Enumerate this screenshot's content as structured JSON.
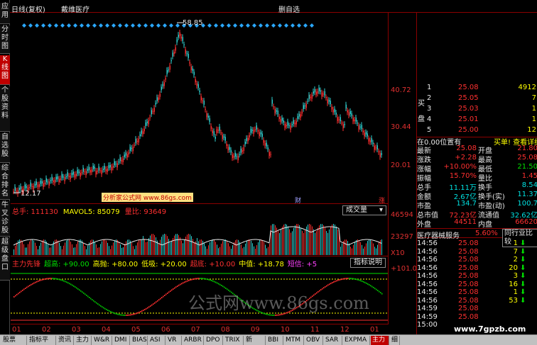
{
  "left_nav": {
    "items": [
      "应用",
      "分时图",
      "K线图",
      "个股资料",
      "自选股",
      "综合排名",
      "牛叉诊股",
      "超级盘口"
    ],
    "active_index": 2
  },
  "header": {
    "period": "日线(复权)",
    "stock_name": "戴维医疗",
    "right_label": "删自选"
  },
  "main_chart": {
    "high_label": "58.85",
    "low_label": "12.17",
    "watermark": "分析家公式网 www.86gs.com",
    "marker_text": "财",
    "marker_text2": "涨",
    "y_ticks": [
      "40.72",
      "30.44",
      "20.01"
    ]
  },
  "volume_chart": {
    "legend_total": "总手: 111130",
    "legend_ma": "MAVOL5: 85079",
    "legend_ratio": "量比: 93649",
    "dropdown": "成交量",
    "y_ticks": [
      "46594",
      "23297",
      "X10"
    ]
  },
  "indicator_chart": {
    "legend": [
      "主力先锋",
      "超高: +90.00",
      "高抛: +80.00",
      "低吸: +20.00",
      "超底: +10.00",
      "中值: +18.78",
      "短信: +5"
    ],
    "button": "指标说明",
    "y_ticks": [
      "+101.0"
    ],
    "watermark": "公式网www.86gs.com"
  },
  "x_axis": [
    "01",
    "02",
    "03",
    "04",
    "05",
    "06",
    "07",
    "08",
    "09",
    "10",
    "11",
    "12",
    "01"
  ],
  "order_book": {
    "sell_label": "买盘",
    "rows": [
      {
        "idx": "1",
        "price": "25.08",
        "vol": "4912"
      },
      {
        "idx": "2",
        "price": "25.05",
        "vol": "7"
      },
      {
        "idx": "3",
        "price": "25.03",
        "vol": "1"
      },
      {
        "idx": "4",
        "price": "25.01",
        "vol": "1"
      },
      {
        "idx": "5",
        "price": "25.00",
        "vol": "12"
      }
    ]
  },
  "info": {
    "position_text": "在0.00位置有",
    "position_action": "买单! 查看详细",
    "stats": [
      {
        "k1": "最新",
        "v1": "25.08",
        "k2": "开盘",
        "v2": "21.80"
      },
      {
        "k1": "涨跌",
        "v1": "+2.28",
        "k2": "最高",
        "v2": "25.08"
      },
      {
        "k1": "涨幅",
        "v1": "+10.00%",
        "k2": "最低",
        "v2": "21.50"
      },
      {
        "k1": "振幅",
        "v1": "15.70%",
        "k2": "量比",
        "v2": "1.45"
      },
      {
        "k1": "总手",
        "v1": "11.11万",
        "k2": "换手",
        "v2": "8.54"
      },
      {
        "k1": "金额",
        "v1": "2.67亿",
        "k2": "换手(实)",
        "v2": "11.37"
      },
      {
        "k1": "市盈",
        "v1": "134.7",
        "k2": "市盈(动)",
        "v2": "100.7"
      },
      {
        "k1": "总市值",
        "v1": "72.23亿",
        "k2": "流通值",
        "v2": "32.62亿"
      },
      {
        "k1": "外盘",
        "v1": "44511",
        "k2": "内盘",
        "v2": "66620"
      }
    ],
    "industry": "医疗器械服务",
    "industry_pct": "5.60%",
    "industry_btn": "同行业比较"
  },
  "trades": [
    {
      "time": "14:56",
      "price": "25.08",
      "vol": "1",
      "dir": "down"
    },
    {
      "time": "14:56",
      "price": "25.08",
      "vol": "7",
      "dir": "down"
    },
    {
      "time": "14:56",
      "price": "25.08",
      "vol": "2",
      "dir": "down"
    },
    {
      "time": "14:56",
      "price": "25.08",
      "vol": "20",
      "dir": "down"
    },
    {
      "time": "14:56",
      "price": "25.08",
      "vol": "3",
      "dir": "down"
    },
    {
      "time": "14:56",
      "price": "25.08",
      "vol": "16",
      "dir": "down"
    },
    {
      "time": "14:56",
      "price": "25.08",
      "vol": "1",
      "dir": "down"
    },
    {
      "time": "14:56",
      "price": "25.08",
      "vol": "53",
      "dir": "down"
    },
    {
      "time": "14:59",
      "price": "25.08",
      "vol": "",
      "dir": ""
    },
    {
      "time": "14:59",
      "price": "25.08",
      "vol": "",
      "dir": ""
    },
    {
      "time": "15:00",
      "price": "",
      "vol": "",
      "dir": ""
    }
  ],
  "site_watermark": "www.7gpzb.com",
  "bottom_tabs": [
    "股票",
    "指标平台",
    "资讯",
    "主力",
    "W&R",
    "DMI",
    "BIAS",
    "ASI",
    "VR",
    "ARBR",
    "DPO",
    "TRIX",
    "新DMA",
    "BBI",
    "MTM",
    "OBV",
    "SAR",
    "EXPMA",
    "主力",
    "细"
  ],
  "bottom_active_index": 18
}
